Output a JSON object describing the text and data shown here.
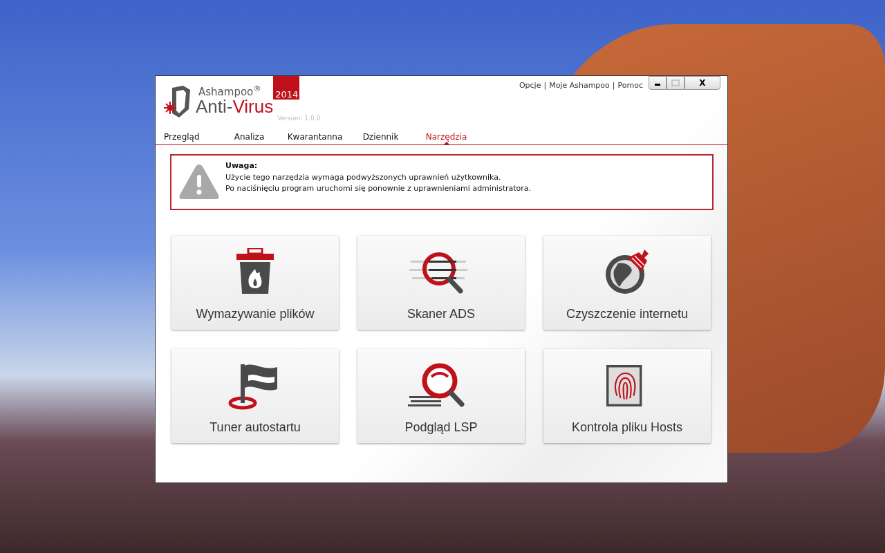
{
  "window": {
    "links": [
      "Opcje",
      "Moje Ashampoo",
      "Pomoc"
    ],
    "link_separator": "|",
    "controls": {
      "close": "X",
      "maximize_disabled": true
    }
  },
  "logo": {
    "brand": "Ashampoo$^{®}$",
    "year": "2014",
    "name_parts": [
      {
        "text": "Anti-",
        "accent": false
      },
      {
        "text": "Virus",
        "accent": true
      }
    ],
    "version": "Version: 1.0.0"
  },
  "tabs": [
    {
      "label": "Przegląd",
      "selected": false
    },
    {
      "label": "Analiza",
      "selected": false
    },
    {
      "label": "Kwarantanna",
      "selected": false
    },
    {
      "label": "Dziennik",
      "selected": false
    },
    {
      "label": "Narzędzia",
      "selected": true
    }
  ],
  "warning": {
    "title": "Uwaga:",
    "lines": [
      "Użycie tego narzędzia wymaga podwyższonych uprawnień użytkownika.",
      "Po naciśnięciu program uruchomi się ponownie z uprawnieniami administratora."
    ]
  },
  "tools": [
    {
      "label": "Wymazywanie plików"
    },
    {
      "label": "Skaner ADS"
    },
    {
      "label": "Czyszczenie internetu"
    },
    {
      "label": "Tuner autostartu"
    },
    {
      "label": "Podgląd LSP"
    },
    {
      "label": "Kontrola pliku Hosts"
    }
  ]
}
